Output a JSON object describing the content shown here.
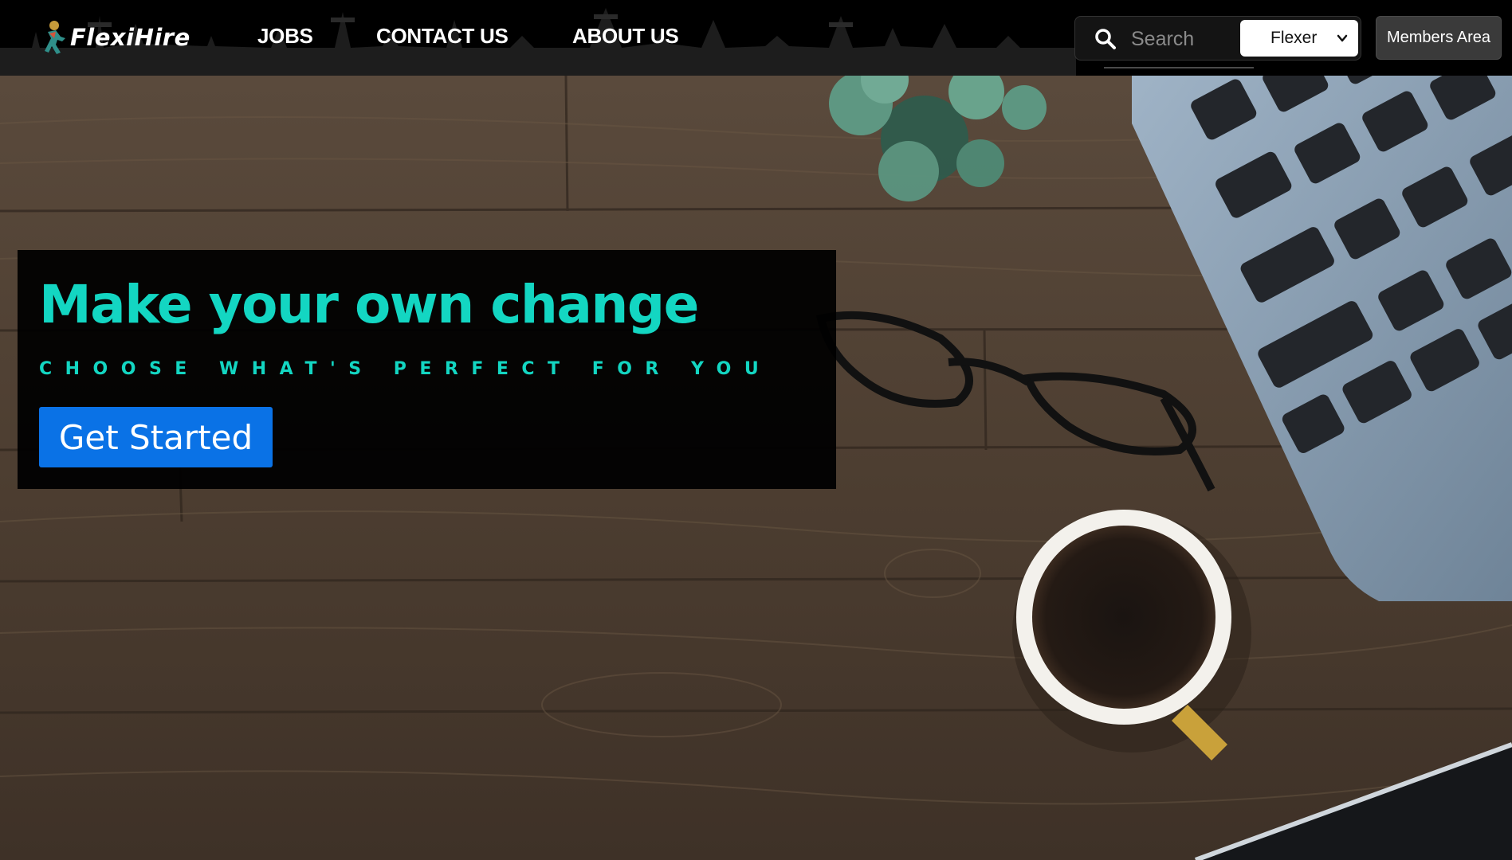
{
  "brand": {
    "name": "FlexiHire",
    "logo_icon": "runner-logo-icon"
  },
  "nav": {
    "links": [
      {
        "label": "JOBS"
      },
      {
        "label": "CONTACT US"
      },
      {
        "label": "ABOUT US"
      }
    ]
  },
  "search": {
    "placeholder": "Search",
    "value": "",
    "icon": "search-icon"
  },
  "role_select": {
    "selected": "Flexer",
    "icon": "chevron-down-icon"
  },
  "members_button": {
    "label": "Members Area"
  },
  "hero": {
    "title": "Make your own change",
    "subtitle": "CHOOSE WHAT'S PERFECT FOR YOU",
    "cta_label": "Get Started"
  },
  "colors": {
    "accent": "#13d6c2",
    "cta": "#0a72e6",
    "navbar": "#000000",
    "card": "#000000"
  }
}
